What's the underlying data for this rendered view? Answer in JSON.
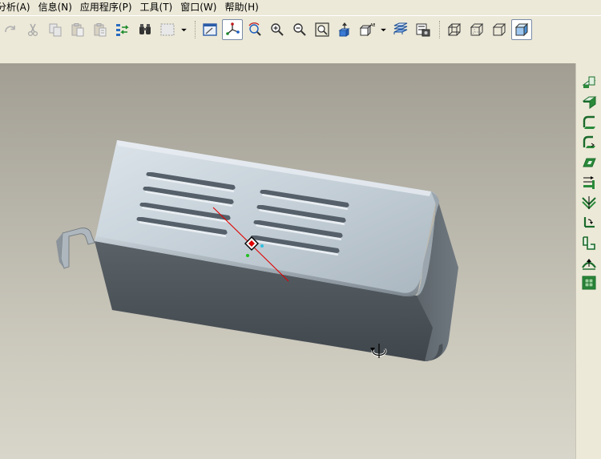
{
  "menubar": {
    "items": [
      "分析(A)",
      "信息(N)",
      "应用程序(P)",
      "工具(T)",
      "窗口(W)",
      "帮助(H)"
    ]
  },
  "toolbar": {
    "buttons": [
      "redo-icon",
      "cut-icon",
      "copy-icon",
      "paste-icon",
      "paste-special-icon",
      "regenerate-icon",
      "find-icon",
      "selection-box-icon",
      "sketch-view-icon",
      "spin-center-icon",
      "orient-mode-icon",
      "zoom-in-icon",
      "zoom-out-icon",
      "refit-icon",
      "reorient-icon",
      "saved-views-icon",
      "layers-icon",
      "view-manager-icon",
      "wireframe-icon",
      "hidden-line-icon",
      "no-hidden-icon",
      "shading-icon"
    ],
    "active": [
      "spin-center-icon",
      "shading-icon"
    ]
  },
  "right_toolbar": {
    "buttons": [
      "flat-wall-icon",
      "flange-wall-icon",
      "unbend-icon",
      "bend-back-icon",
      "extrude-cut-icon",
      "form-icon",
      "bend-icon",
      "edge-bend-icon",
      "rip-icon",
      "corner-relief-icon",
      "convert-icon"
    ]
  },
  "colors": {
    "ui_bg": "#ece9d8",
    "viewport_top": "#a29e93",
    "viewport_bottom": "#d8d6ca",
    "part_top": "#c5d0d8",
    "part_side": "#4e555b",
    "spin_axis": "#e00000"
  }
}
